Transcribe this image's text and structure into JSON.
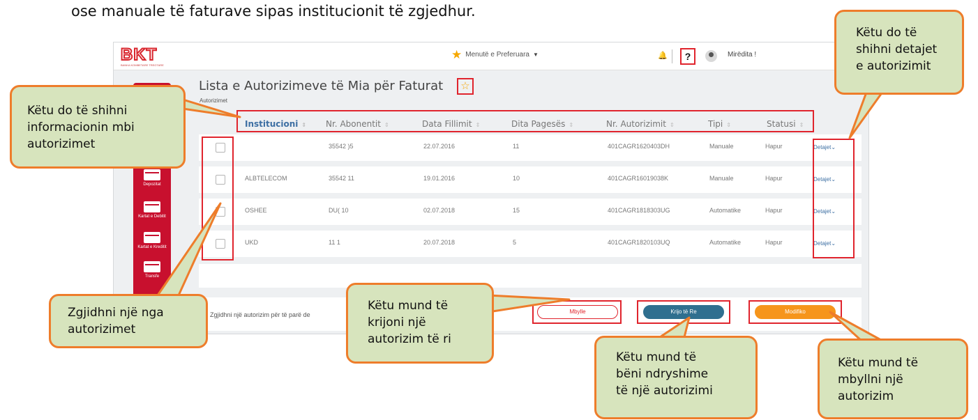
{
  "intro_text": "ose manuale të faturave sipas institucionit të zgjedhur.",
  "app": {
    "logo": "BKT",
    "logo_sub": "BANKA KOMBETARE TREGTARE",
    "favorites": "Menutë e Preferuara",
    "help": "?",
    "greeting": "Mirëdita !",
    "sidebar": [
      "Depozitat",
      "Kartat e Debitit",
      "Kartat e Kreditit",
      "Transfe"
    ],
    "page_title": "Lista e Autorizimeve të Mia për Faturat",
    "breadcrumb": "Autorizimet",
    "columns": [
      "Institucioni",
      "Nr. Abonentit",
      "Data Fillimit",
      "Dita Pagesës",
      "Nr. Autorizimit",
      "Tipi",
      "Statusi"
    ],
    "rows": [
      {
        "institucioni": "",
        "nr_abonentit": "35542 )5",
        "data_fillimit": "22.07.2016",
        "dita_pageses": "11",
        "nr_autorizimit": "401CAGR1620403DH",
        "tipi": "Manuale",
        "statusi": "Hapur",
        "detajet": "Detajet"
      },
      {
        "institucioni": "ALBTELECOM",
        "nr_abonentit": "35542 11",
        "data_fillimit": "19.01.2016",
        "dita_pageses": "10",
        "nr_autorizimit": "401CAGR16019038K",
        "tipi": "Manuale",
        "statusi": "Hapur",
        "detajet": "Detajet"
      },
      {
        "institucioni": "OSHEE",
        "nr_abonentit": "DU( 10",
        "data_fillimit": "02.07.2018",
        "dita_pageses": "15",
        "nr_autorizimit": "401CAGR1818303UG",
        "tipi": "Automatike",
        "statusi": "Hapur",
        "detajet": "Detajet"
      },
      {
        "institucioni": "UKD",
        "nr_abonentit": "11 1",
        "data_fillimit": "20.07.2018",
        "dita_pageses": "5",
        "nr_autorizimit": "401CAGR1820103UQ",
        "tipi": "Automatike",
        "statusi": "Hapur",
        "detajet": "Detajet"
      }
    ],
    "footer_hint": "Zgjidhni një autorizim për të parë de",
    "buttons": {
      "close": "Mbylle",
      "new": "Krijo të Re",
      "modify": "Modifiko"
    }
  },
  "callouts": {
    "details": "Këtu do të\nshihni detajet\ne autorizimit",
    "info": "Këtu do të shihni\ninformacionin mbi\nautorizimet",
    "select": "Zgjidhni një nga\nautorizimet",
    "create": "Këtu mund të\nkrijoni një\nautorizim të ri",
    "modify": "Këtu mund të\nbëni ndryshime\ntë një autorizimi",
    "close": "Këtu mund të\nmbyllni një\nautorizim"
  },
  "colors": {
    "accent_red": "#e0242d",
    "brand_red": "#c8102e",
    "callout_fill": "#d7e4bd",
    "callout_border": "#ee7d2b",
    "create_button": "#2f6f8f",
    "modify_button": "#f6951b"
  }
}
